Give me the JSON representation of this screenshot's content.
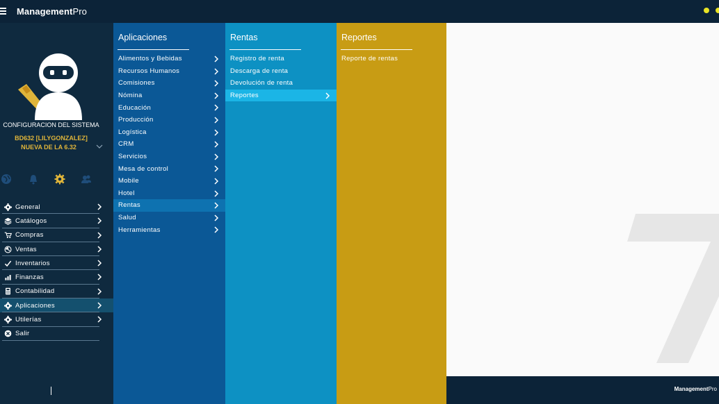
{
  "header": {
    "brand_bold": "Management",
    "brand_light": "Pro",
    "status_colors": [
      "#e9e325",
      "#e9e325"
    ]
  },
  "sidebar": {
    "system_title": "CONFIGURACION DEL SISTEMA",
    "db_line1": "BD632 [LILYGONZALEZ]",
    "db_line2": "NUEVA DE LA 6.32",
    "quick_icons": [
      "globe-icon",
      "bell-icon",
      "gear-icon",
      "users-icon"
    ],
    "items": [
      {
        "label": "General",
        "icon": "gear-icon"
      },
      {
        "label": "Catálogos",
        "icon": "layers-icon"
      },
      {
        "label": "Compras",
        "icon": "cart-icon"
      },
      {
        "label": "Ventas",
        "icon": "sales-icon"
      },
      {
        "label": "Inventarios",
        "icon": "check-icon"
      },
      {
        "label": "Finanzas",
        "icon": "bar-chart-icon"
      },
      {
        "label": "Contabilidad",
        "icon": "calculator-icon"
      },
      {
        "label": "Aplicaciones",
        "icon": "gear-icon"
      },
      {
        "label": "Utilerías",
        "icon": "gear-icon"
      },
      {
        "label": "Salir",
        "icon": "close-circle-icon"
      }
    ],
    "active_item": "Aplicaciones"
  },
  "apps_menu": {
    "title": "Aplicaciones",
    "items": [
      "Alimentos y Bebidas",
      "Recursos Humanos",
      "Comisiones",
      "Nómina",
      "Educación",
      "Producción",
      "Logística",
      "CRM",
      "Servicios",
      "Mesa de control",
      "Mobile",
      "Hotel",
      "Rentas",
      "Salud",
      "Herramientas"
    ],
    "active_item": "Rentas"
  },
  "rentas_menu": {
    "title": "Rentas",
    "items": [
      "Registro de renta",
      "Descarga de renta",
      "Devolución de renta",
      "Reportes"
    ],
    "active_item": "Reportes"
  },
  "reportes_menu": {
    "title": "Reportes",
    "items": [
      "Reporte de rentas"
    ]
  },
  "footer": {
    "brand_bold": "Management",
    "brand_light": "Pro"
  },
  "colors": {
    "topbar": "#0c2338",
    "sidebar": "#0f2a3f",
    "apps_column": "#0b5896",
    "rentas_column": "#0d91c3",
    "reportes_column": "#c89c14",
    "accent_gold": "#e0b53a"
  }
}
